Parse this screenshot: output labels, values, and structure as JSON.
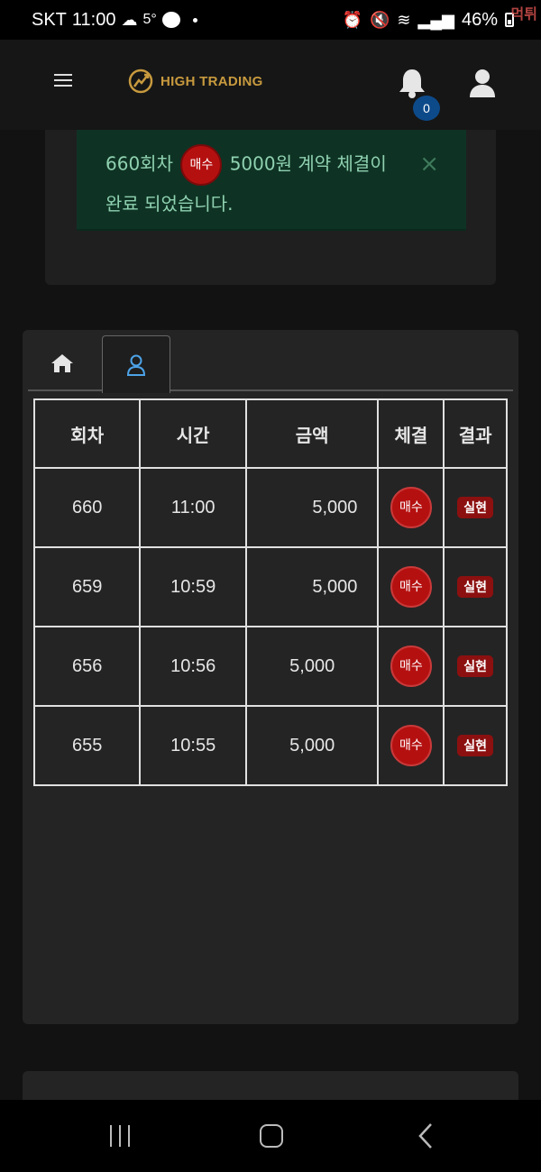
{
  "status_bar": {
    "carrier": "SKT",
    "time": "11:00",
    "temperature": "5°",
    "battery": "46%",
    "watermark": "먹튀"
  },
  "header": {
    "brand": "HIGH TRADING",
    "notification_count": "0",
    "brand_color": "#c89a3e"
  },
  "alert": {
    "text_before": "660회차",
    "pill_label": "매수",
    "text_after": "5000원 계약 체결이 완료 되었습니다.",
    "close_label": "×"
  },
  "tabs": [
    {
      "name": "home",
      "icon": "home-icon",
      "active": false
    },
    {
      "name": "user",
      "icon": "user-icon",
      "active": true
    }
  ],
  "table": {
    "headers": [
      "회차",
      "시간",
      "금액",
      "체결",
      "결과"
    ],
    "rows": [
      {
        "round": "660",
        "time": "11:00",
        "amount": "5,000",
        "trade": "매수",
        "result": "실현"
      },
      {
        "round": "659",
        "time": "10:59",
        "amount": "5,000",
        "trade": "매수",
        "result": "실현"
      },
      {
        "round": "656",
        "time": "10:56",
        "amount": "5,000",
        "trade": "매수",
        "result": "실현"
      },
      {
        "round": "655",
        "time": "10:55",
        "amount": "5,000",
        "trade": "매수",
        "result": "실현"
      }
    ]
  },
  "colors": {
    "buy": "#b51010",
    "realized": "#8c1010",
    "alert_bg": "#0e3324",
    "alert_text": "#8fd1b0"
  }
}
